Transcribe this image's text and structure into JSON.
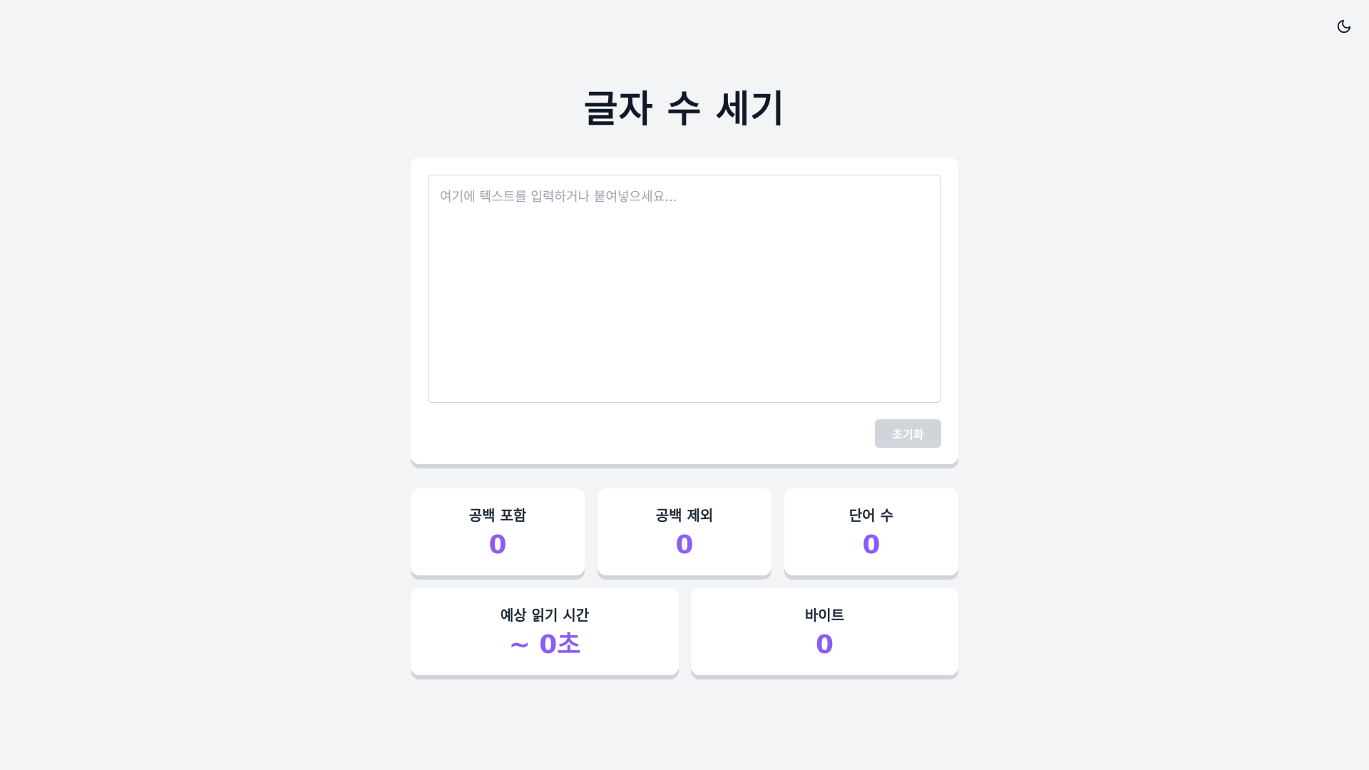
{
  "header": {
    "title": "글자 수 세기",
    "theme_toggle_icon": "moon-icon"
  },
  "editor": {
    "placeholder": "여기에 텍스트를 입력하거나 붙여넣으세요...",
    "value": "",
    "reset_label": "초기화"
  },
  "stats": {
    "with_spaces": {
      "label": "공백 포함",
      "value": "0"
    },
    "without_spaces": {
      "label": "공백 제외",
      "value": "0"
    },
    "words": {
      "label": "단어 수",
      "value": "0"
    },
    "reading_time": {
      "label": "예상 읽기 시간",
      "value": "~ 0초"
    },
    "bytes": {
      "label": "바이트",
      "value": "0"
    }
  },
  "colors": {
    "background": "#f3f4f6",
    "card": "#ffffff",
    "accent": "#8b5cf6",
    "button_disabled": "#d1d5db"
  }
}
